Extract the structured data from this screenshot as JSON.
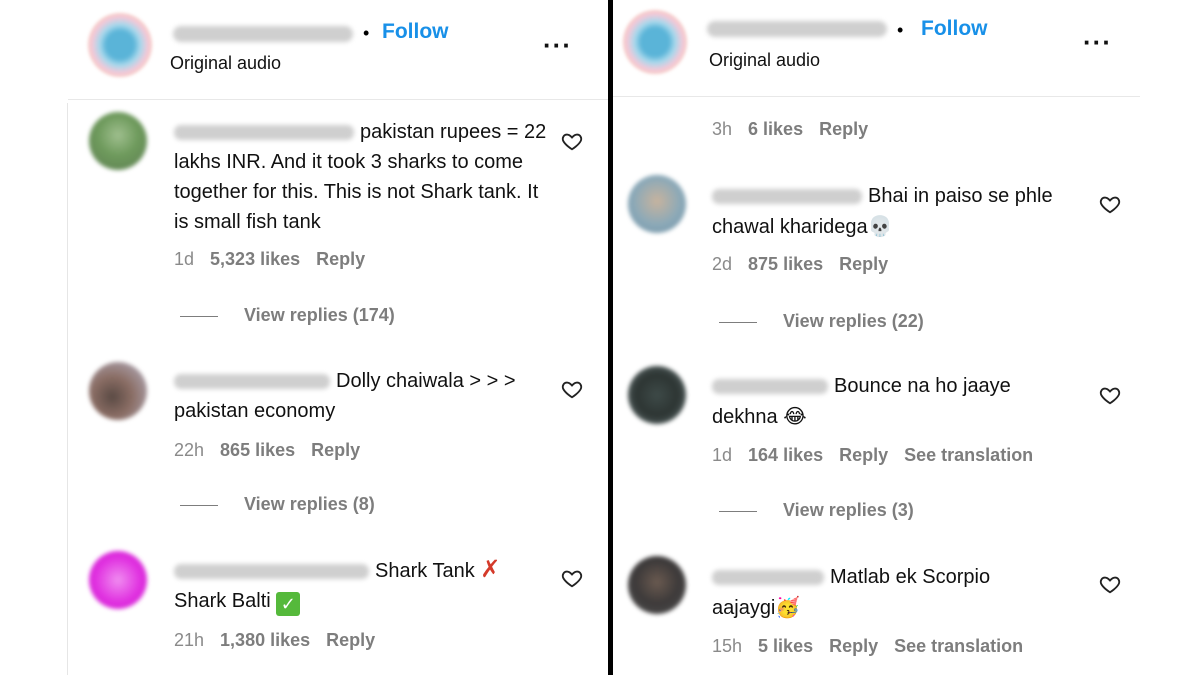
{
  "left": {
    "header": {
      "follow": "Follow",
      "subtitle": "Original audio",
      "more": "•••"
    },
    "comments": [
      {
        "text": "pakistan rupees = 22 lakhs INR. And it took 3 sharks to come together for this. This is not Shark tank. It is small fish tank",
        "time": "1d",
        "likes": "5,323 likes",
        "reply": "Reply",
        "view_replies": "View replies (174)"
      },
      {
        "text": "Dolly chaiwala > > > pakistan economy",
        "time": "22h",
        "likes": "865 likes",
        "reply": "Reply",
        "view_replies": "View replies (8)"
      },
      {
        "text_a": "Shark Tank",
        "text_b": "Shark Balti",
        "time": "21h",
        "likes": "1,380 likes",
        "reply": "Reply"
      }
    ]
  },
  "right": {
    "header": {
      "follow": "Follow",
      "subtitle": "Original audio",
      "more": "•••"
    },
    "top_meta": {
      "time": "3h",
      "likes": "6 likes",
      "reply": "Reply"
    },
    "comments": [
      {
        "text_a": "Bhai in paiso se phle",
        "text_b": "chawal kharidega",
        "time": "2d",
        "likes": "875 likes",
        "reply": "Reply",
        "view_replies": "View replies (22)"
      },
      {
        "text_a": "Bounce na ho jaaye",
        "text_b": "dekhna",
        "time": "1d",
        "likes": "164 likes",
        "reply": "Reply",
        "translation": "See translation",
        "view_replies": "View replies (3)"
      },
      {
        "text_a": "Matlab ek Scorpio",
        "text_b": "aajaygi",
        "time": "15h",
        "likes": "5 likes",
        "reply": "Reply",
        "translation": "See translation"
      }
    ]
  },
  "icons": {
    "heart": "heart-outline-icon",
    "skull": "skull-emoji",
    "laugh": "tears-of-joy-emoji",
    "party": "partying-face-emoji"
  },
  "colors": {
    "follow": "#1890e8",
    "meta": "#8a8a8a"
  }
}
